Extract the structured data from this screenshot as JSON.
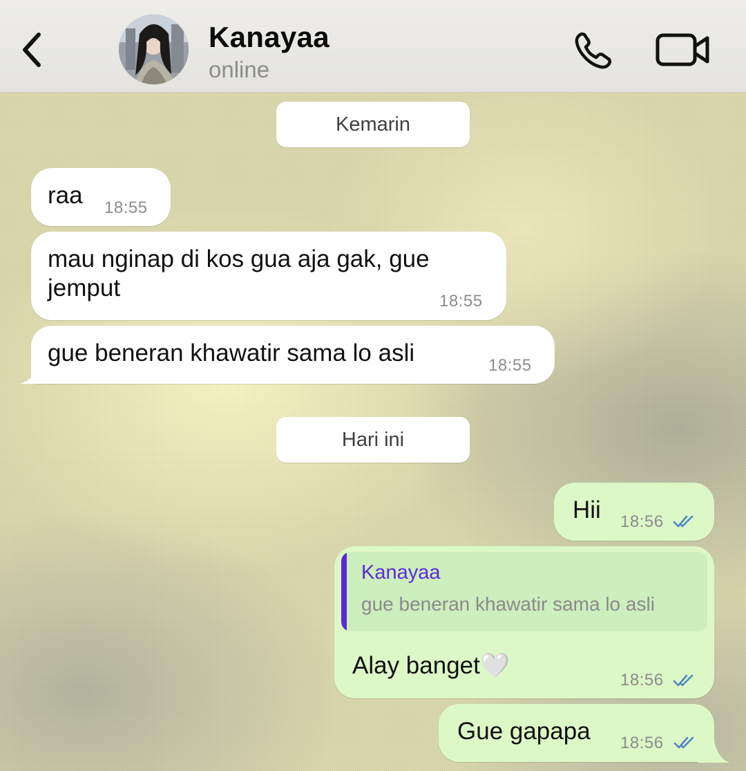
{
  "header": {
    "contact_name": "Kanayaa",
    "status": "online",
    "icons": {
      "back": "chevron-left-icon",
      "call": "phone-icon",
      "video": "video-camera-icon"
    }
  },
  "chat": {
    "date_separators": [
      "Kemarin",
      "Hari ini"
    ],
    "incoming": [
      {
        "text": "raa",
        "time": "18:55"
      },
      {
        "text": "mau nginap di kos gua aja gak, gue\njemput",
        "time": "18:55"
      },
      {
        "text": "gue beneran khawatir sama lo asli",
        "time": "18:55"
      }
    ],
    "outgoing": [
      {
        "text": "Hii",
        "time": "18:56",
        "status": "read"
      },
      {
        "reply_to": {
          "name": "Kanayaa",
          "text": "gue beneran khawatir sama lo asli"
        },
        "text": "Alay banget🤍",
        "time": "18:56",
        "status": "read"
      },
      {
        "text": "Gue gapapa",
        "time": "18:56",
        "status": "read"
      }
    ]
  },
  "colors": {
    "incoming_bubble": "#ffffff",
    "outgoing_bubble": "#dcf8c6",
    "read_ticks": "#4f86c6",
    "reply_accent": "#5b2ad8"
  }
}
